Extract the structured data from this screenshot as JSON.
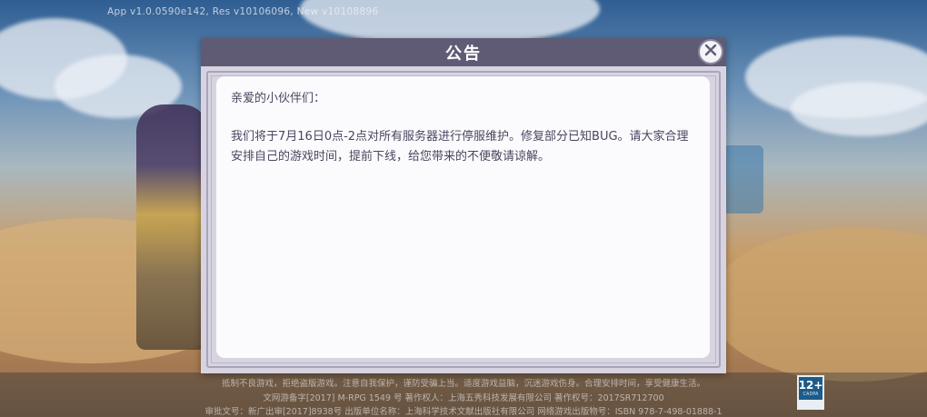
{
  "version_text": "App v1.0.0590e142, Res v10106096, New v10108896",
  "dialog": {
    "title": "公告",
    "greeting": "亲爱的小伙伴们：",
    "body": "我们将于7月16日0点-2点对所有服务器进行停服维护。修复部分已知BUG。请大家合理安排自己的游戏时间，提前下线，给您带来的不便敬请谅解。"
  },
  "footer": {
    "line1": "抵制不良游戏，拒绝盗版游戏。注意自我保护，谨防受骗上当。适度游戏益脑，沉迷游戏伤身。合理安排时间，享受健康生活。",
    "line2": "文网游备字[2017] M-RPG 1549 号 著作权人：上海五秀科技发展有限公司 著作权号：2017SR712700",
    "line3": "审批文号：新广出审[2017]8938号 出版单位名称：上海科学技术文献出版社有限公司 网络游戏出版物号：ISBN 978-7-498-01888-1",
    "age_rating": "12+",
    "age_sub": "CADPA"
  },
  "icons": {
    "close": "close-x-icon"
  },
  "colors": {
    "header": "#5f5b75",
    "panel": "#fbfafc",
    "text": "#4a4660"
  }
}
